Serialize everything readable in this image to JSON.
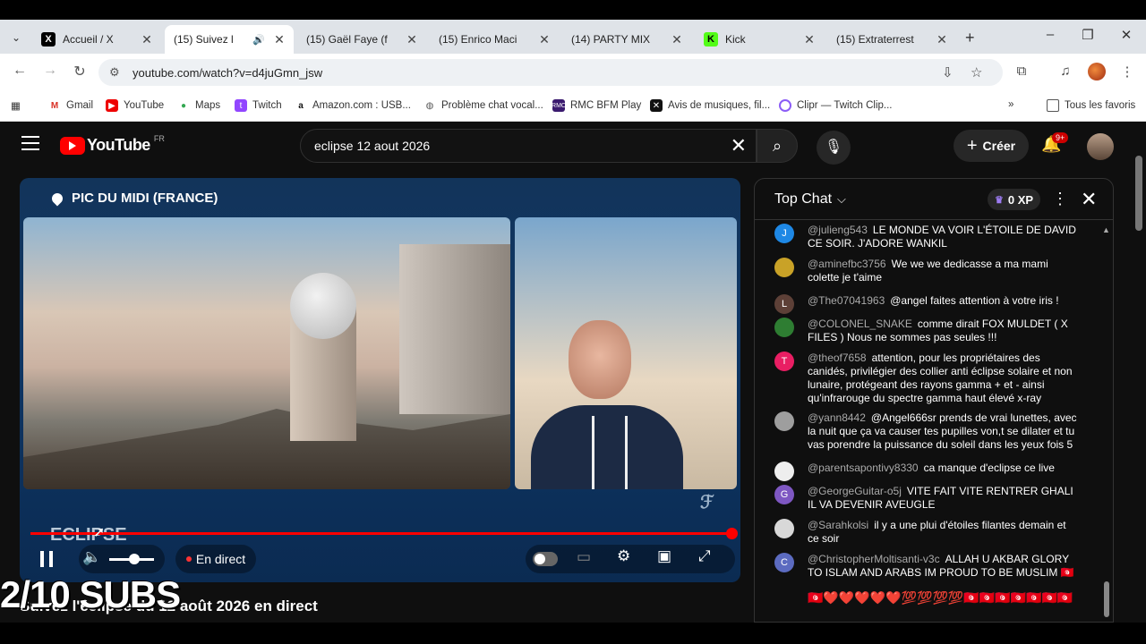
{
  "browser": {
    "tabs": [
      {
        "label": "Accueil / X",
        "icon": "x-icon"
      },
      {
        "label": "(15) Suivez l",
        "icon": "youtube-icon",
        "active": true
      },
      {
        "label": "(15) Gaël Faye (f",
        "icon": "youtube-icon"
      },
      {
        "label": "(15) Enrico Maci",
        "icon": "youtube-icon"
      },
      {
        "label": "(14) PARTY MIX",
        "icon": "youtube-icon"
      },
      {
        "label": "Kick",
        "icon": "kick-icon"
      },
      {
        "label": "(15) Extraterrest",
        "icon": "youtube-icon"
      }
    ],
    "url": "youtube.com/watch?v=d4juGmn_jsw",
    "bookmarks": [
      {
        "label": "Gmail"
      },
      {
        "label": "YouTube"
      },
      {
        "label": "Maps"
      },
      {
        "label": "Twitch"
      },
      {
        "label": "Amazon.com : USB..."
      },
      {
        "label": "Problème chat vocal..."
      },
      {
        "label": "RMC BFM Play"
      },
      {
        "label": "Avis de musiques, fil..."
      },
      {
        "label": "Clipr — Twitch Clip..."
      }
    ],
    "all_bookmarks": "Tous les favoris",
    "overflow": "»"
  },
  "youtube": {
    "logo_text": "YouTube",
    "country": "FR",
    "search_query": "eclipse 12 aout 2026",
    "create_label": "Créer",
    "notif_badge": "9+"
  },
  "player": {
    "location": "PIC DU MIDI (FRANCE)",
    "logo": "ECLIPSE",
    "live_label": "En direct",
    "progress": 1.0
  },
  "video": {
    "title": "Suivez l'éclipse du 12 août 2026 en direct",
    "overlay": "2/10 SUBS"
  },
  "chat": {
    "title": "Top Chat",
    "xp": "0 XP",
    "messages": [
      {
        "author": "@julieng543",
        "text": "LE MONDE VA VOIR L'ÉTOILE DE DAVID CE SOIR. J'ADORE WANKIL",
        "avatar": "J",
        "color": "#1e88e5"
      },
      {
        "author": "@aminefbc3756",
        "text": "We we we dedicasse a ma mami colette je t'aime",
        "avatar": "",
        "color": "#c9a227"
      },
      {
        "author": "@The07041963",
        "text": "@angel faites attention à votre iris !",
        "avatar": "L",
        "color": "#5d4037"
      },
      {
        "author": "@COLONEL_SNAKE",
        "text": "comme dirait FOX MULDET ( X FILES ) Nous ne sommes pas seules !!!",
        "avatar": "",
        "color": "#2e7d32"
      },
      {
        "author": "@theof7658",
        "text": "attention, pour les propriétaires des canidés, privilégier des collier anti éclipse solaire et non lunaire, protégeant des rayons gamma + et - ainsi qu'infrarouge du spectre gamma haut élevé x-ray",
        "avatar": "T",
        "color": "#e91e63"
      },
      {
        "author": "@yann8442",
        "text": "@Angel666sr prends de vrai lunettes, avec la nuit que ça va causer tes pupilles von,t se dilater et tu vas porendre la puissance du soleil dans les yeux fois 5",
        "avatar": "",
        "color": "#9e9e9e"
      },
      {
        "author": "@parentsapontivy8330",
        "text": "ca manque d'eclipse ce live",
        "avatar": "",
        "color": "#eeeeee"
      },
      {
        "author": "@GeorgeGuitar-o5j",
        "text": "VITE FAIT VITE RENTRER GHALI IL VA DEVENIR AVEUGLE",
        "avatar": "G",
        "color": "#7e57c2"
      },
      {
        "author": "@Sarahkolsi",
        "text": "il y a une plui d'étoiles filantes demain et ce soir",
        "avatar": "",
        "color": "#d8d8d8"
      },
      {
        "author": "@ChristopherMoltisanti-v3c",
        "text": "ALLAH U AKBAR GLORY TO ISLAM AND ARABS IM PROUD TO BE MUSLIM 🇹🇳",
        "avatar": "C",
        "color": "#5c6bc0"
      }
    ],
    "emoji_line": "🇹🇳❤️❤️❤️❤️❤️💯💯💯💯🇹🇳🇹🇳🇹🇳🇹🇳🇹🇳🇹🇳🇹🇳"
  }
}
